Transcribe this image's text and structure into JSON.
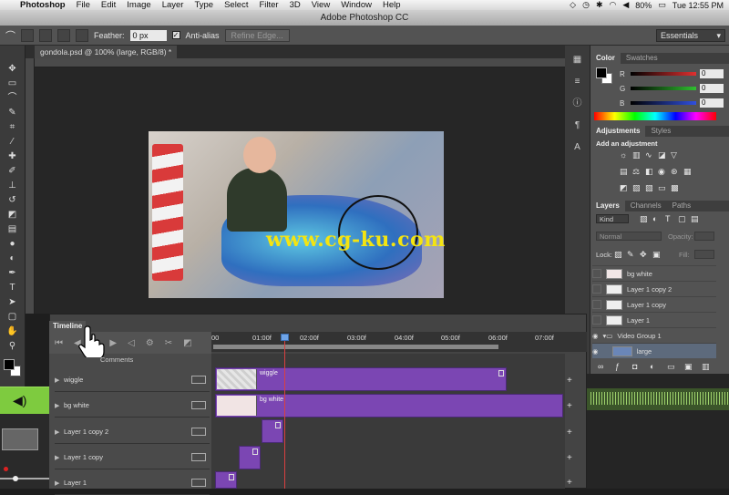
{
  "menubar": {
    "app": "Photoshop",
    "items": [
      "File",
      "Edit",
      "Image",
      "Layer",
      "Type",
      "Select",
      "Filter",
      "3D",
      "View",
      "Window",
      "Help"
    ],
    "battery": "80%",
    "clock": "Tue 12:55 PM"
  },
  "window": {
    "title": "Adobe Photoshop CC"
  },
  "options": {
    "feather_label": "Feather:",
    "feather_value": "0 px",
    "antialias_label": "Anti-alias",
    "refine_label": "Refine Edge...",
    "workspace": "Essentials"
  },
  "document": {
    "tab": "gondola.psd @ 100% (large, RGB/8) *"
  },
  "watermark": "www.cg-ku.com",
  "panels": {
    "color_tabs": [
      "Color",
      "Swatches"
    ],
    "sliders": [
      {
        "label": "R",
        "value": "0",
        "color": "#e03030"
      },
      {
        "label": "G",
        "value": "0",
        "color": "#30c030"
      },
      {
        "label": "B",
        "value": "0",
        "color": "#3050e0"
      }
    ],
    "adjust_tabs": [
      "Adjustments",
      "Styles"
    ],
    "adjust_title": "Add an adjustment",
    "layer_tabs": [
      "Layers",
      "Channels",
      "Paths"
    ],
    "kind": "Kind",
    "blend": "Normal",
    "opacity_label": "Opacity:",
    "lock_label": "Lock:",
    "fill_label": "Fill:",
    "layers": [
      "bg white",
      "Layer 1 copy 2",
      "Layer 1 copy",
      "Layer 1",
      "Video Group 1",
      "large"
    ]
  },
  "timeline": {
    "tab": "Timeline",
    "ticks": [
      "00",
      "01:00f",
      "02:00f",
      "03:00f",
      "04:00f",
      "05:00f",
      "06:00f",
      "07:00f"
    ],
    "comments": "Comments",
    "tracks": [
      "wiggle",
      "bg white",
      "Layer 1 copy 2",
      "Layer 1 copy",
      "Layer 1"
    ],
    "clips": [
      "wiggle",
      "bg white"
    ]
  },
  "colors": {
    "clip": "#7b46b3",
    "playhead": "#d94040",
    "watermark": "#f4e411"
  }
}
